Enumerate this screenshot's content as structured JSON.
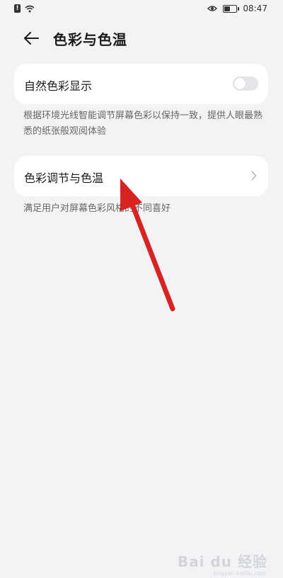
{
  "status_bar": {
    "time": "08:47",
    "battery_level": 0.5,
    "icons": [
      "alert-icon",
      "wifi-icon",
      "eye-icon",
      "battery-icon"
    ]
  },
  "header": {
    "title": "色彩与色温",
    "back_icon": "arrow-left-icon"
  },
  "settings": [
    {
      "label": "自然色彩显示",
      "control": "toggle",
      "toggle_on": false,
      "description": "根据环境光线智能调节屏幕色彩以保持一致，提供人眼最熟悉的纸张般观阅体验"
    },
    {
      "label": "色彩调节与色温",
      "control": "chevron",
      "description": "满足用户对屏幕色彩风格的不同喜好"
    }
  ],
  "colors": {
    "background": "#f1f3f5",
    "card": "#ffffff",
    "annotation_arrow": "#d92323"
  },
  "watermark": {
    "text": "Bai du 经验",
    "sub": "jingyan.baidu.com"
  }
}
